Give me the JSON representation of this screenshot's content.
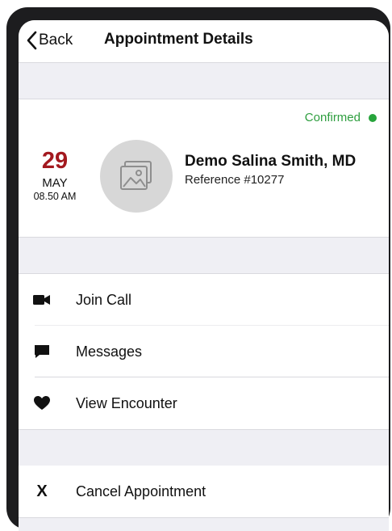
{
  "nav": {
    "back_label": "Back",
    "title": "Appointment Details"
  },
  "appointment": {
    "status": "Confirmed",
    "status_color": "#26a43b",
    "date_day": "29",
    "date_month": "MAY",
    "date_time": "08.50 AM",
    "doctor_name": "Demo Salina Smith, MD",
    "reference": "Reference #10277",
    "avatar_icon": "image-placeholder-icon"
  },
  "actions": [
    {
      "label": "Join Call",
      "icon": "video-camera-icon"
    },
    {
      "label": "Messages",
      "icon": "chat-bubble-icon"
    },
    {
      "label": "View Encounter",
      "icon": "heart-icon"
    }
  ],
  "cancel": {
    "label": "Cancel Appointment",
    "icon_glyph": "X"
  },
  "colors": {
    "accent_red": "#a3191f",
    "status_green": "#26a43b",
    "group_background": "#efeff4"
  }
}
